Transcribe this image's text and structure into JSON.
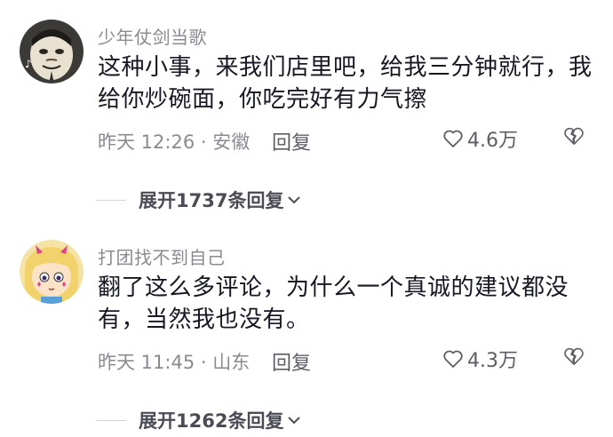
{
  "comments": [
    {
      "username": "少年仗剑当歌",
      "text": "这种小事，来我们店里吧，给我三分钟就行，我给你炒碗面，你吃完好有力气擦",
      "meta": "昨天 12:26 · 安徽",
      "reply_label": "回复",
      "likes": "4.6万",
      "expand_label": "展开1737条回复",
      "avatar": "masked-face-avatar"
    },
    {
      "username": "打团找不到自己",
      "text": "翻了这么多评论，为什么一个真诚的建议都没有，当然我也没有。",
      "meta": "昨天 11:45 · 山东",
      "reply_label": "回复",
      "likes": "4.3万",
      "expand_label": "展开1262条回复",
      "avatar": "cartoon-girl-avatar"
    }
  ],
  "colors": {
    "primary_text": "#161823",
    "secondary_text": "#8a8b91",
    "action_text": "#5d5e66"
  }
}
